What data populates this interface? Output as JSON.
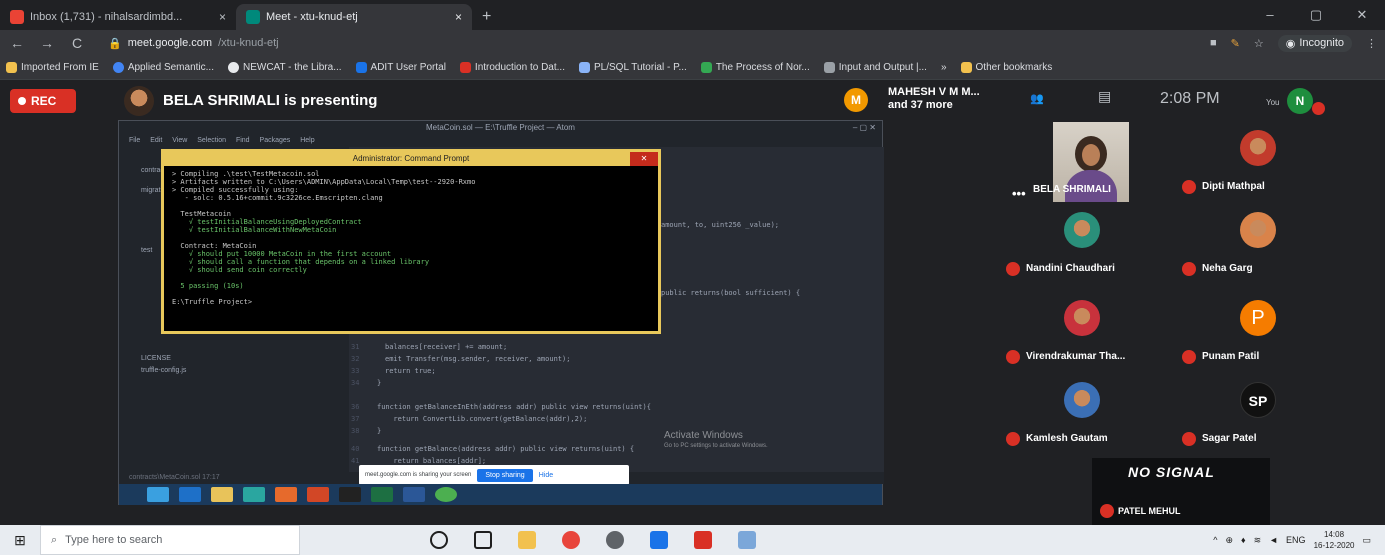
{
  "browser": {
    "tabs": [
      {
        "label": "Inbox (1,731) - nihalsardimbd...",
        "close": "×"
      },
      {
        "label": "Meet - xtu-knud-etj",
        "close": "×"
      }
    ],
    "new_tab": "+",
    "window_controls": [
      "–",
      "▢",
      "✕"
    ],
    "nav": {
      "back": "←",
      "forward": "→",
      "reload": "C"
    },
    "url_host": "meet.google.com",
    "url_path": "/xtu-knud-etj",
    "incognito_label": "Incognito",
    "menu": "⋮",
    "bookmarks": [
      "Imported From IE",
      "Applied Semantic...",
      "NEWCAT - the Libra...",
      "ADIT User Portal",
      "Introduction to Dat...",
      "PL/SQL Tutorial - P...",
      "The Process of Nor...",
      "Input and Output |...",
      "»",
      "Other bookmarks"
    ]
  },
  "meet": {
    "rec_label": "REC",
    "presenting_text": "BELA SHRIMALI is presenting",
    "others_avatar": "M",
    "others_line1": "MAHESH V M M...",
    "others_line2": "and 37 more",
    "time": "2:08 PM",
    "you_label": "You",
    "self_avatar": "N",
    "participants": [
      {
        "name": "Dipti Mathpal",
        "color": "#c23b2c"
      },
      {
        "name": "Nandini Chaudhari",
        "color": "#2a8f7a"
      },
      {
        "name": "Neha Garg",
        "color": "#d9834a"
      },
      {
        "name": "Virendrakumar Tha...",
        "color": "#c8323c"
      },
      {
        "name": "Punam Patil",
        "color": "#f57c00",
        "initial": "P"
      },
      {
        "name": "Kamlesh Gautam",
        "color": "#3b6fb5"
      },
      {
        "name": "Sagar Patel",
        "color": "#111111",
        "initial": "SP"
      }
    ],
    "presenter_tile_name": "BELA SHRIMALI",
    "presenter_dots": "•••",
    "no_signal_text": "NO SIGNAL",
    "no_signal_name": "PATEL MEHUL",
    "share_banner_text": "meet.google.com is sharing your screen",
    "stop_sharing": "Stop sharing",
    "hide": "Hide"
  },
  "shared_screen": {
    "atom_title": "MetaCoin.sol — E:\\Truffle Project — Atom",
    "atom_menu": "File Edit View Selection Find Packages Help",
    "tree_items": [
      "contracts",
      "migrations",
      "test",
      "LICENSE",
      "truffle-config.js"
    ],
    "cmd_title": "Administrator: Command Prompt",
    "cmd_lines": [
      "> Compiling .\\test\\TestMetacoin.sol",
      "> Artifacts written to C:\\Users\\ADMIN\\AppData\\Local\\Temp\\test--2920-Rxmo",
      "",
      "> Compiled successfully using:",
      "   - solc: 0.5.16+commit.9c3226ce.Emscripten.clang",
      "",
      "  TestMetacoin",
      "    √ testInitialBalanceUsingDeployedContract",
      "    √ testInitialBalanceWithNewMetaCoin",
      "",
      "  Contract: MetaCoin",
      "    √ should put 10000 MetaCoin in the first account",
      "    √ should call a function that depends on a linked library",
      "    √ should send coin correctly",
      "",
      "  5 passing (10s)",
      "",
      "E:\\Truffle Project>"
    ],
    "code_lines": [
      "amount, to, uint256 _value);",
      "",
      "public returns(bool sufficient) {",
      "",
      "balances[receiver] += amount;",
      "emit Transfer(msg.sender, receiver, amount);",
      "return true;",
      "}",
      "",
      "function getBalanceInEth(address addr) public view returns(uint){",
      "  return ConvertLib.convert(getBalance(addr),2);",
      "}",
      "",
      "function getBalance(address addr) public view returns(uint) {",
      "  return balances[addr];",
      "}",
      "}"
    ],
    "status_left": "contracts\\MetaCoin.sol  17:17",
    "activate_title": "Activate Windows",
    "activate_sub": "Go to PC settings to activate Windows."
  },
  "taskbar": {
    "search_placeholder": "Type here to search",
    "lang": "ENG",
    "time": "14:08",
    "date": "16-12-2020"
  }
}
